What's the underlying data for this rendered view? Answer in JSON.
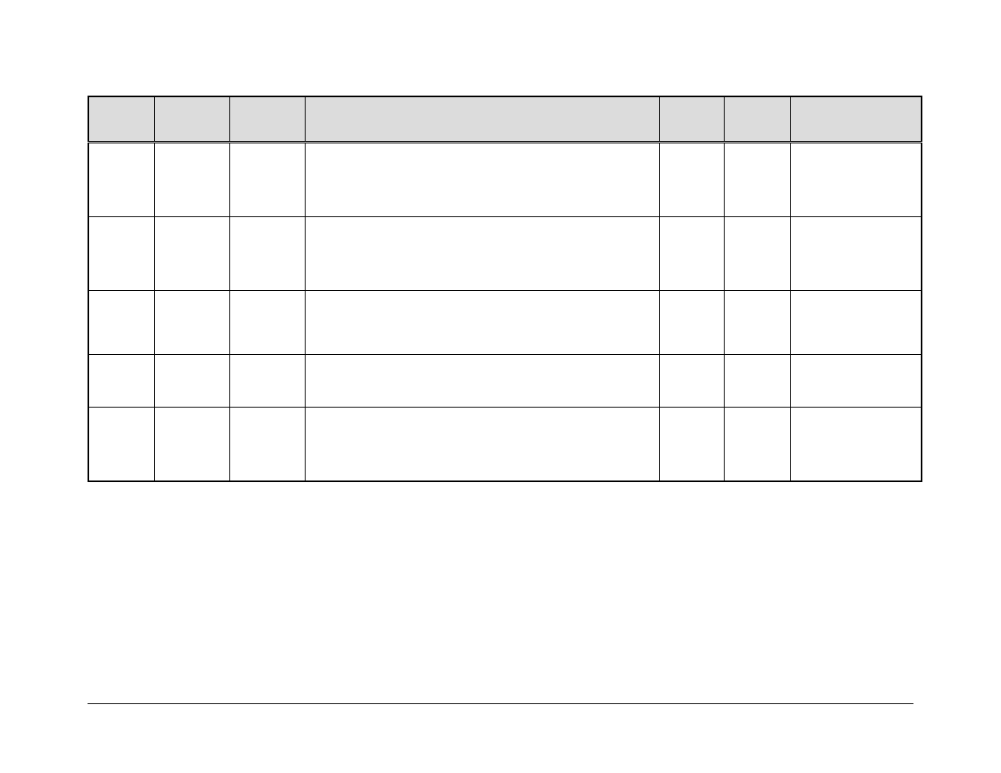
{
  "table": {
    "headers": [
      "",
      "",
      "",
      "",
      "",
      "",
      ""
    ],
    "rows": [
      [
        "",
        "",
        "",
        "",
        "",
        "",
        ""
      ],
      [
        "",
        "",
        "",
        "",
        "",
        "",
        ""
      ],
      [
        "",
        "",
        "",
        "",
        "",
        "",
        ""
      ],
      [
        "",
        "",
        "",
        "",
        "",
        "",
        ""
      ],
      [
        "",
        "",
        "",
        "",
        "",
        "",
        ""
      ]
    ]
  }
}
